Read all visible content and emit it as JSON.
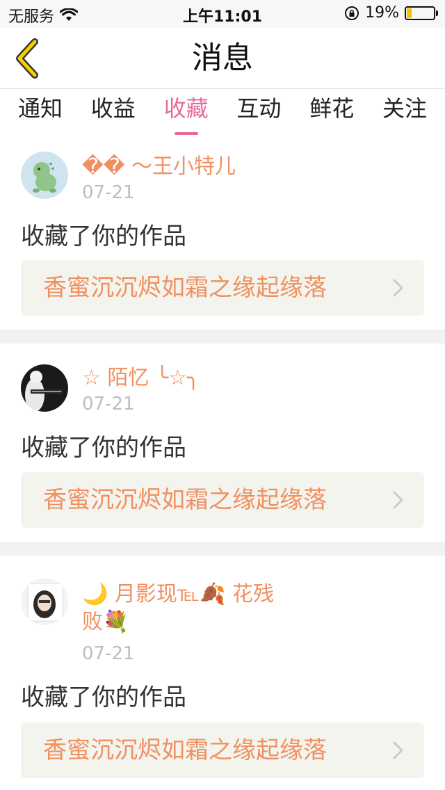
{
  "status_bar": {
    "carrier": "无服务",
    "time": "上午11:01",
    "battery_percent": "19%",
    "battery_level": 0.19,
    "battery_fill_color": "#f5c400"
  },
  "nav": {
    "title": "消息",
    "back_icon": "chevron-left-icon",
    "back_icon_color": "#f5d000"
  },
  "tabs": [
    {
      "label": "通知",
      "active": false
    },
    {
      "label": "收益",
      "active": false
    },
    {
      "label": "收藏",
      "active": true
    },
    {
      "label": "互动",
      "active": false
    },
    {
      "label": "鲜花",
      "active": false
    },
    {
      "label": "关注",
      "active": false
    }
  ],
  "accent_color": "#e86a9b",
  "name_color": "#f09060",
  "messages": [
    {
      "user_name": "�� ～王小特儿",
      "date": "07-21",
      "action": "收藏了你的作品",
      "work_title": "香蜜沉沉烬如霜之缘起缘落",
      "avatar_icon": "green-dinosaur-avatar"
    },
    {
      "user_name": "☆ 陌忆 ╰☆╮",
      "date": "07-21",
      "action": "收藏了你的作品",
      "work_title": "香蜜沉沉烬如霜之缘起缘落",
      "avatar_icon": "dark-portrait-avatar"
    },
    {
      "user_name_line1": "🌙 月影现℡🍂 花残",
      "user_name_line2": "败💐",
      "date": "07-21",
      "action": "收藏了你的作品",
      "work_title": "香蜜沉沉烬如霜之缘起缘落",
      "avatar_icon": "girl-portrait-avatar"
    }
  ]
}
